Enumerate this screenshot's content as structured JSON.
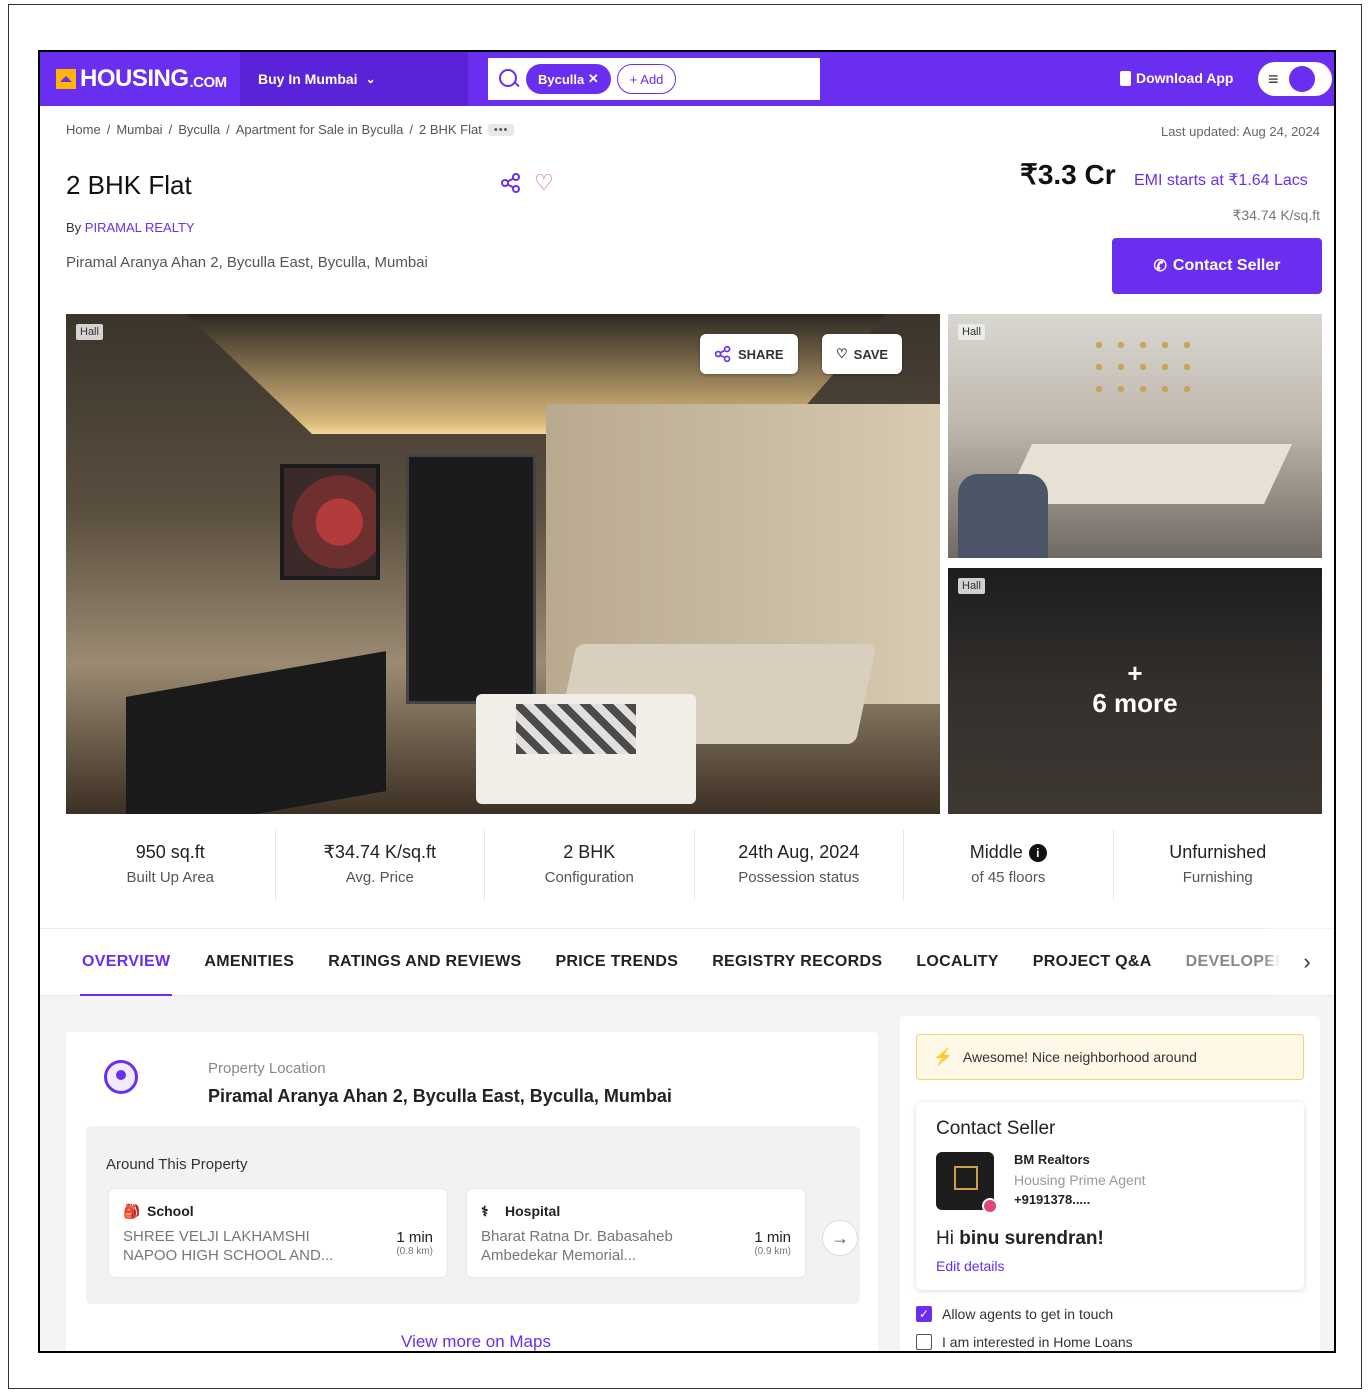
{
  "header": {
    "logo": "HOUSING",
    "logo_suffix": ".COM",
    "city_menu": "Buy In Mumbai",
    "search_chip": "Byculla",
    "add_chip": "+ Add",
    "download": "Download App"
  },
  "breadcrumbs": [
    "Home",
    "Mumbai",
    "Byculla",
    "Apartment for Sale in Byculla",
    "2 BHK Flat"
  ],
  "last_updated": "Last updated: Aug 24, 2024",
  "listing": {
    "title": "2 BHK Flat",
    "by_prefix": "By",
    "developer": "PIRAMAL REALTY",
    "address": "Piramal Aranya Ahan 2, Byculla East, Byculla, Mumbai",
    "price": "₹3.3 Cr",
    "emi": "EMI starts at ₹1.64 Lacs",
    "price_per_sqft": "₹34.74 K/sq.ft",
    "contact_button": "Contact Seller"
  },
  "gallery": {
    "main_tag": "Hall",
    "share": "SHARE",
    "save": "SAVE",
    "thumb1_tag": "Hall",
    "thumb2_tag": "Hall",
    "more_plus": "+",
    "more_label": "6 more"
  },
  "stats": [
    {
      "value": "950 sq.ft",
      "label": "Built Up Area"
    },
    {
      "value": "₹34.74 K/sq.ft",
      "label": "Avg. Price"
    },
    {
      "value": "2 BHK",
      "label": "Configuration"
    },
    {
      "value": "24th Aug, 2024",
      "label": "Possession status"
    },
    {
      "value": "Middle",
      "label": "of 45 floors"
    },
    {
      "value": "Unfurnished",
      "label": "Furnishing"
    }
  ],
  "tabs": [
    "OVERVIEW",
    "AMENITIES",
    "RATINGS AND REVIEWS",
    "PRICE TRENDS",
    "REGISTRY RECORDS",
    "LOCALITY",
    "PROJECT Q&A",
    "DEVELOPER"
  ],
  "location": {
    "label": "Property Location",
    "address": "Piramal Aranya Ahan 2, Byculla East, Byculla, Mumbai",
    "around_title": "Around This Property",
    "pois": [
      {
        "type": "School",
        "name": "SHREE VELJI LAKHAMSHI NAPOO HIGH SCHOOL AND...",
        "time": "1 min",
        "dist": "(0.8 km)"
      },
      {
        "type": "Hospital",
        "name": "Bharat Ratna Dr. Babasaheb Ambedekar Memorial...",
        "time": "1 min",
        "dist": "(0.9 km)"
      }
    ],
    "view_more": "View more on Maps"
  },
  "side": {
    "banner": "Awesome! Nice neighborhood around",
    "contact_title": "Contact Seller",
    "agent_name": "BM Realtors",
    "agent_role": "Housing Prime Agent",
    "agent_phone": "+9191378.....",
    "greet_prefix": "Hi",
    "greet_name": "binu surendran!",
    "edit": "Edit details",
    "check1": "Allow agents to get in touch",
    "check2": "I am interested in Home Loans"
  },
  "colors": {
    "brand": "#6a2ef0",
    "accent": "#ffb400"
  }
}
